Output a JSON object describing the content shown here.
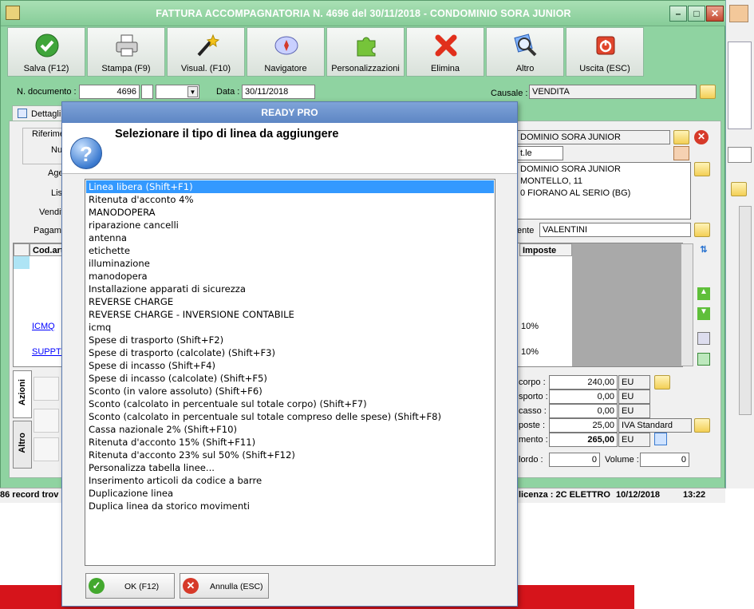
{
  "window": {
    "title": "FATTURA ACCOMPAGNATORIA N. 4696 del 30/11/2018 - CONDOMINIO SORA JUNIOR"
  },
  "toolbar": [
    {
      "label": "Salva (F12)",
      "icon": "save-check-icon"
    },
    {
      "label": "Stampa (F9)",
      "icon": "printer-icon"
    },
    {
      "label": "Visual. (F10)",
      "icon": "magic-wand-icon"
    },
    {
      "label": "Navigatore",
      "icon": "compass-icon"
    },
    {
      "label": "Personalizzazioni",
      "icon": "puzzle-icon"
    },
    {
      "label": "Elimina",
      "icon": "delete-x-icon"
    },
    {
      "label": "Altro",
      "icon": "magnifier-icon"
    },
    {
      "label": "Uscita (ESC)",
      "icon": "power-icon"
    }
  ],
  "header": {
    "num_doc_label": "N. documento :",
    "num_doc": "4696",
    "data_label": "Data :",
    "data": "30/11/2018",
    "causale_label": "Causale :",
    "causale": "VENDITA"
  },
  "tabs": {
    "dettaglio": "Dettagli",
    "azioni": "Azioni",
    "altro": "Altro"
  },
  "left_labels": {
    "riferim": "Riferime",
    "num": "Nu",
    "age": "Age",
    "lis": "Lis",
    "vendit": "Vendit",
    "pagame": "Pagame"
  },
  "client": {
    "name": "DOMINIO SORA JUNIOR",
    "code": "t.le",
    "address1": "DOMINIO SORA JUNIOR",
    "address2": "MONTELLO, 11",
    "address3": "0 FIORANO AL SERIO (BG)",
    "agente_label": "ente",
    "agente": "VALENTINI"
  },
  "grid": {
    "col_code": "Cod.art.",
    "col_imposte": "Imposte",
    "rows": [
      {
        "code": "ICMQ",
        "imposte": "10%"
      },
      {
        "code": "SUPPTEC",
        "imposte": "10%"
      }
    ]
  },
  "totals": {
    "corpo_label": "corpo :",
    "corpo": "240,00",
    "corpo_cur": "EU",
    "trasporto_label": "sporto :",
    "trasporto": "0,00",
    "trasporto_cur": "EU",
    "incasso_label": "casso :",
    "incasso": "0,00",
    "incasso_cur": "EU",
    "imposte_label": "poste :",
    "imposte": "25,00",
    "imposte_type": "IVA Standard",
    "pagamento_label": "mento :",
    "pagamento": "265,00",
    "pagamento_cur": "EU",
    "lordo_label": "lordo :",
    "lordo": "0",
    "volume_label": "Volume :",
    "volume": "0"
  },
  "status": {
    "records": "86 record trov",
    "licenza": "licenza : 2C ELETTRO",
    "date": "10/12/2018",
    "time": "13:22"
  },
  "dialog": {
    "title": "READY PRO",
    "prompt": "Selezionare il tipo di linea da aggiungere",
    "selected_index": 0,
    "items": [
      "Linea libera (Shift+F1)",
      "Ritenuta d'acconto 4%",
      "MANODOPERA",
      "riparazione cancelli",
      "antenna",
      "etichette",
      "illuminazione",
      "manodopera",
      "Installazione apparati di sicurezza",
      "REVERSE CHARGE",
      "REVERSE CHARGE - INVERSIONE CONTABILE",
      "icmq",
      "Spese di trasporto (Shift+F2)",
      "Spese di trasporto (calcolate) (Shift+F3)",
      "Spese di incasso (Shift+F4)",
      "Spese di incasso (calcolate) (Shift+F5)",
      "Sconto (in valore assoluto) (Shift+F6)",
      "Sconto (calcolato in percentuale sul totale corpo) (Shift+F7)",
      "Sconto (calcolato in percentuale sul totale compreso delle spese) (Shift+F8)",
      "Cassa nazionale 2% (Shift+F10)",
      "Ritenuta d'acconto 15% (Shift+F11)",
      "Ritenuta d'acconto 23% sul 50% (Shift+F12)",
      "Personalizza tabella linee...",
      "Inserimento articoli da codice a barre",
      "Duplicazione linea",
      "Duplica linea da storico movimenti"
    ],
    "ok_label": "OK (F12)",
    "cancel_label": "Annulla (ESC)"
  },
  "colors": {
    "window_bg": "#8fd3a1",
    "selection": "#3399ff",
    "dialog_title": "#5d86c4",
    "red_banner": "#d6141b"
  }
}
